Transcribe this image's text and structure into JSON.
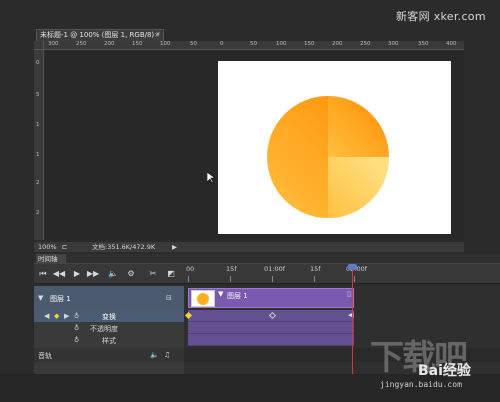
{
  "watermark": {
    "top": "新客网 xker.com",
    "bottom_big": "下载吧",
    "bottom_brand": "Bai经验",
    "bottom_url": "jingyan.baidu.com"
  },
  "document": {
    "tab_title": "未标题-1 @ 100% (图层 1, RGB/8) *",
    "close_glyph": "×",
    "zoom": "100%",
    "doc_size": "文档:351.6K/472.9K"
  },
  "rulers": {
    "horizontal": [
      "300",
      "250",
      "200",
      "150",
      "100",
      "50",
      "0",
      "50",
      "100",
      "150",
      "200",
      "250",
      "300",
      "350",
      "400"
    ],
    "vertical": [
      "0",
      "5",
      "1",
      "1",
      "2",
      "2"
    ]
  },
  "canvas": {
    "pie_colors": {
      "light": "#ffe48a",
      "mid": "#ffc040",
      "dark": "#ff8c00"
    }
  },
  "timeline": {
    "panel_title": "时间轴",
    "time_labels": [
      "00",
      "15f",
      "01:00f",
      "15f",
      "02:00f"
    ],
    "layer_name": "图层 1",
    "clip_label": "图层 1",
    "properties": [
      "变换",
      "不透明度",
      "样式"
    ],
    "audio_track": "音轨",
    "controls": {
      "first_frame": "⏮",
      "prev_frame": "◀◀",
      "play": "▶",
      "next_frame": "▶▶",
      "audio": "🔈",
      "settings": "⚙",
      "split": "✂",
      "transition": "◩"
    }
  },
  "colors": {
    "clip": "#7a5ab0",
    "selected_row": "#4a5b74",
    "playhead": "#d23b3b",
    "keyframe": "#f2d23a"
  }
}
